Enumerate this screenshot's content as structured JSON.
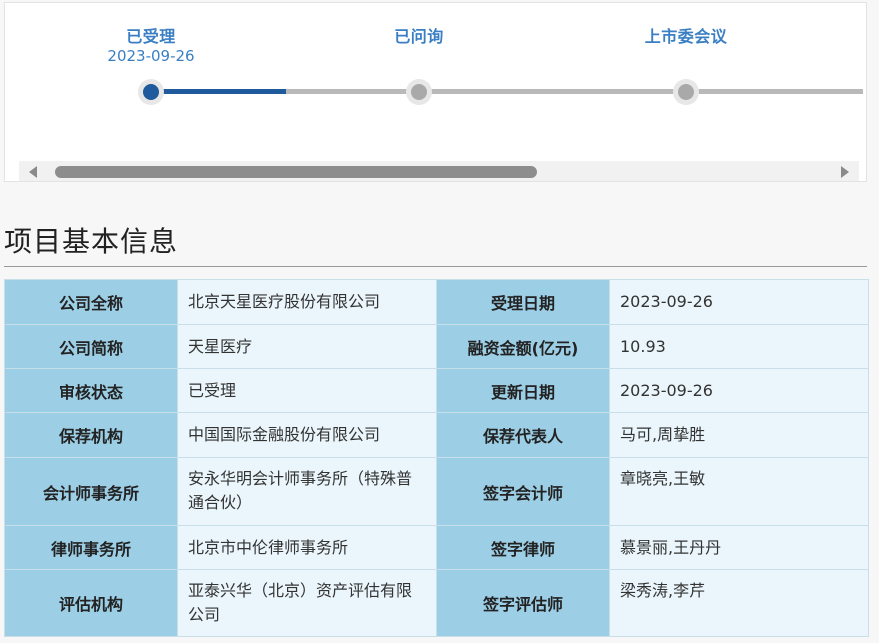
{
  "progress": {
    "stages": [
      {
        "label": "已受理",
        "date": "2023-09-26",
        "active": true
      },
      {
        "label": "已问询",
        "date": "",
        "active": false
      },
      {
        "label": "上市委会议",
        "date": "",
        "active": false
      }
    ],
    "fill_fraction": 0.19,
    "scroll_position_fraction": 0.0
  },
  "section": {
    "title": "项目基本信息"
  },
  "info": {
    "company_full_name": {
      "label": "公司全称",
      "value": "北京天星医疗股份有限公司"
    },
    "accept_date": {
      "label": "受理日期",
      "value": "2023-09-26"
    },
    "company_short_name": {
      "label": "公司简称",
      "value": "天星医疗"
    },
    "financing_amount": {
      "label": "融资金额(亿元)",
      "value": "10.93"
    },
    "review_status": {
      "label": "审核状态",
      "value": "已受理"
    },
    "update_date": {
      "label": "更新日期",
      "value": "2023-09-26"
    },
    "sponsor": {
      "label": "保荐机构",
      "value": "中国国际金融股份有限公司"
    },
    "sponsor_rep": {
      "label": "保荐代表人",
      "value": "马可,周挚胜"
    },
    "accounting_firm": {
      "label": "会计师事务所",
      "value": "安永华明会计师事务所（特殊普通合伙）"
    },
    "signing_accountant": {
      "label": "签字会计师",
      "value": "章晓亮,王敏"
    },
    "law_firm": {
      "label": "律师事务所",
      "value": "北京市中伦律师事务所"
    },
    "signing_lawyer": {
      "label": "签字律师",
      "value": "慕景丽,王丹丹"
    },
    "appraisal_firm": {
      "label": "评估机构",
      "value": "亚泰兴华（北京）资产评估有限公司"
    },
    "signing_appraiser": {
      "label": "签字评估师",
      "value": "梁秀涛,李芹"
    }
  },
  "colors": {
    "accent": "#3a7fc4",
    "track_fill": "#1e5a9c",
    "key_cell": "#9ccfe6",
    "value_cell": "#eaf6fb"
  }
}
